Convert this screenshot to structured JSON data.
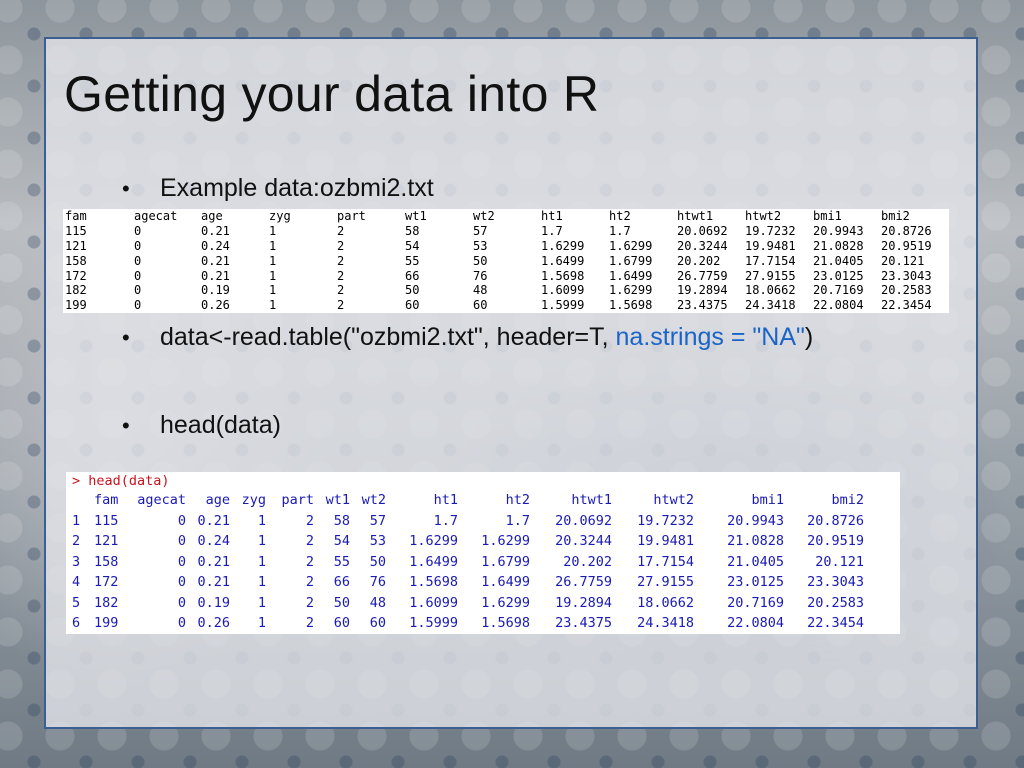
{
  "slide": {
    "title": "Getting your data into R",
    "bullets": [
      {
        "text": "Example data:ozbmi2.txt"
      },
      {
        "text_before": "data<-read.table(\"ozbmi2.txt\", header=T, ",
        "text_highlight": "na.strings = \"NA\"",
        "text_after": ")"
      },
      {
        "text": "head(data)"
      }
    ],
    "bullet_glyph": "•",
    "highlight_color": "#1a64c8"
  },
  "raw_file_table": {
    "headers": [
      "fam",
      "agecat",
      "age",
      "zyg",
      "part",
      "wt1",
      "wt2",
      "ht1",
      "ht2",
      "htwt1",
      "htwt2",
      "bmi1",
      "bmi2"
    ],
    "rows": [
      [
        "115",
        "0",
        "0.21",
        "1",
        "2",
        "58",
        "57",
        "1.7",
        "1.7",
        "20.0692",
        "19.7232",
        "20.9943",
        "20.8726"
      ],
      [
        "121",
        "0",
        "0.24",
        "1",
        "2",
        "54",
        "53",
        "1.6299",
        "1.6299",
        "20.3244",
        "19.9481",
        "21.0828",
        "20.9519"
      ],
      [
        "158",
        "0",
        "0.21",
        "1",
        "2",
        "55",
        "50",
        "1.6499",
        "1.6799",
        "20.202",
        "17.7154",
        "21.0405",
        "20.121"
      ],
      [
        "172",
        "0",
        "0.21",
        "1",
        "2",
        "66",
        "76",
        "1.5698",
        "1.6499",
        "26.7759",
        "27.9155",
        "23.0125",
        "23.3043"
      ],
      [
        "182",
        "0",
        "0.19",
        "1",
        "2",
        "50",
        "48",
        "1.6099",
        "1.6299",
        "19.2894",
        "18.0662",
        "20.7169",
        "20.2583"
      ],
      [
        "199",
        "0",
        "0.26",
        "1",
        "2",
        "60",
        "60",
        "1.5999",
        "1.5698",
        "23.4375",
        "24.3418",
        "22.0804",
        "22.3454"
      ]
    ]
  },
  "r_console": {
    "command": "> head(data)",
    "headers": [
      "",
      "fam",
      "agecat",
      "age",
      "zyg",
      "part",
      "wt1",
      "wt2",
      "ht1",
      "ht2",
      "htwt1",
      "htwt2",
      "bmi1",
      "bmi2"
    ],
    "rows": [
      [
        "1",
        "115",
        "0",
        "0.21",
        "1",
        "2",
        "58",
        "57",
        "1.7",
        "1.7",
        "20.0692",
        "19.7232",
        "20.9943",
        "20.8726"
      ],
      [
        "2",
        "121",
        "0",
        "0.24",
        "1",
        "2",
        "54",
        "53",
        "1.6299",
        "1.6299",
        "20.3244",
        "19.9481",
        "21.0828",
        "20.9519"
      ],
      [
        "3",
        "158",
        "0",
        "0.21",
        "1",
        "2",
        "55",
        "50",
        "1.6499",
        "1.6799",
        "20.202",
        "17.7154",
        "21.0405",
        "20.121"
      ],
      [
        "4",
        "172",
        "0",
        "0.21",
        "1",
        "2",
        "66",
        "76",
        "1.5698",
        "1.6499",
        "26.7759",
        "27.9155",
        "23.0125",
        "23.3043"
      ],
      [
        "5",
        "182",
        "0",
        "0.19",
        "1",
        "2",
        "50",
        "48",
        "1.6099",
        "1.6299",
        "19.2894",
        "18.0662",
        "20.7169",
        "20.2583"
      ],
      [
        "6",
        "199",
        "0",
        "0.26",
        "1",
        "2",
        "60",
        "60",
        "1.5999",
        "1.5698",
        "23.4375",
        "24.3418",
        "22.0804",
        "22.3454"
      ]
    ],
    "command_color": "#c8141e",
    "output_color": "#1a1ab4"
  }
}
